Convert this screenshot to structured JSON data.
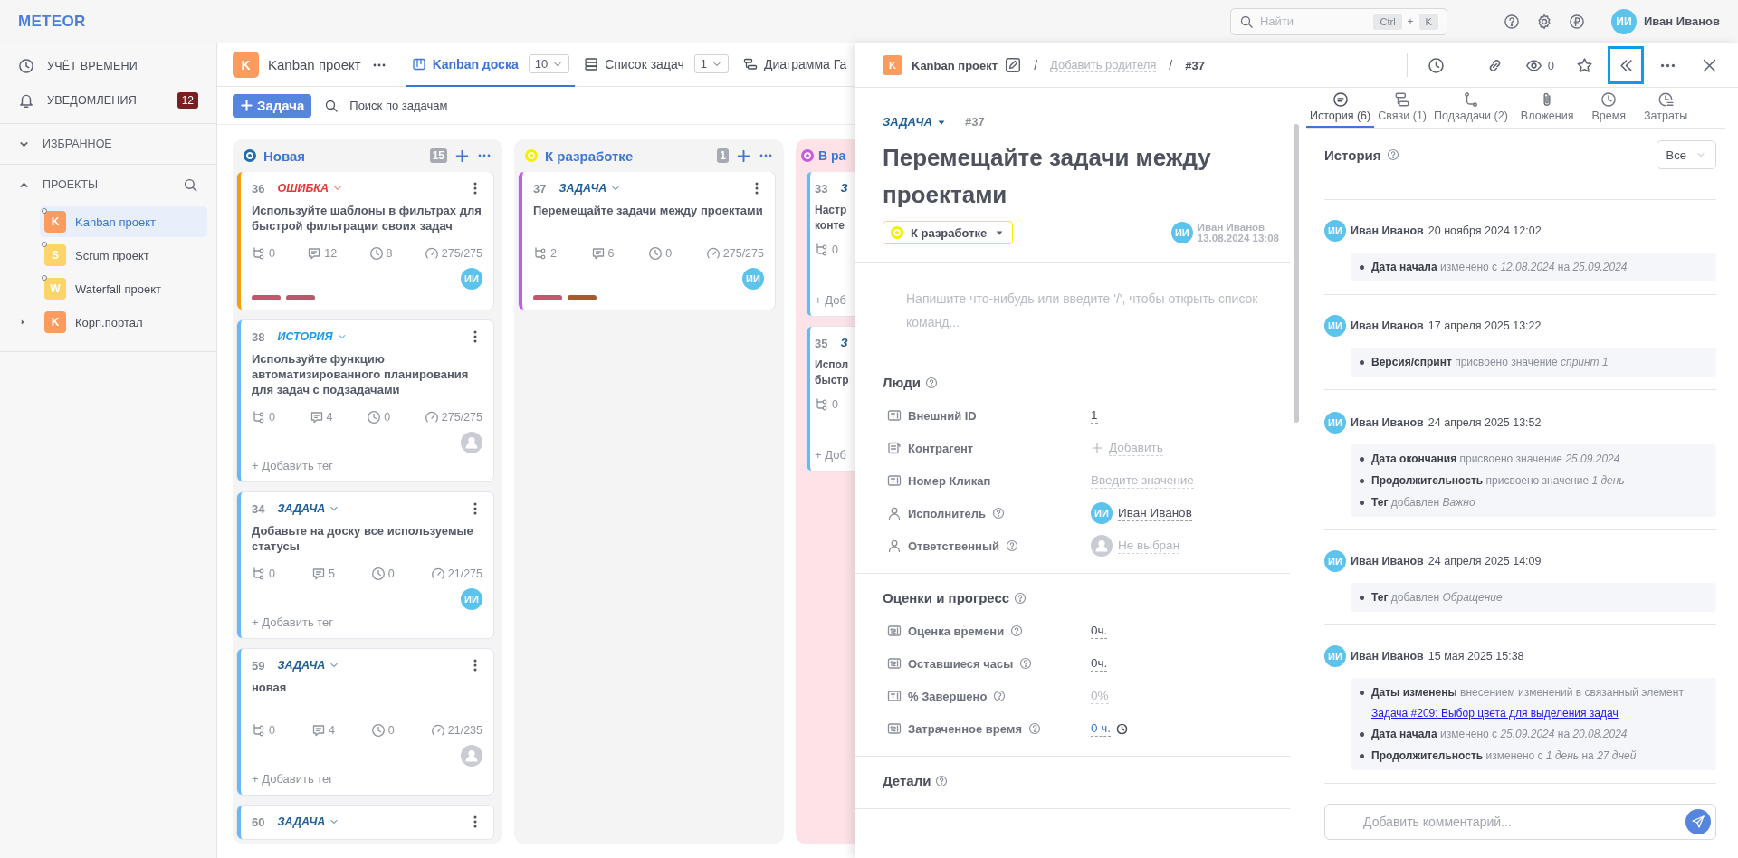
{
  "app": {
    "logo": "METEOR"
  },
  "topbar": {
    "search": {
      "placeholder": "Найти",
      "keys": [
        "Ctrl",
        "+",
        "K"
      ]
    },
    "user": {
      "initials": "ИИ",
      "name": "Иван Иванов"
    }
  },
  "sidebar": {
    "items": [
      {
        "kind": "time",
        "label": "УЧЁТ ВРЕМЕНИ"
      },
      {
        "kind": "notifications",
        "label": "УВЕДОМЛЕНИЯ",
        "badge": "12"
      }
    ],
    "sections": [
      {
        "label": "ИЗБРАННОЕ",
        "expanded": false,
        "searchable": false
      },
      {
        "label": "ПРОЕКТЫ",
        "expanded": true,
        "searchable": true
      }
    ],
    "projects": [
      {
        "letter": "K",
        "name": "Kanban проект",
        "color": "#fb9b5e",
        "selected": true,
        "pinned": true,
        "collapsed": false
      },
      {
        "letter": "S",
        "name": "Scrum проект",
        "color": "#fcd46a",
        "selected": false,
        "pinned": true,
        "collapsed": false
      },
      {
        "letter": "W",
        "name": "Waterfall проект",
        "color": "#fcd46a",
        "selected": false,
        "pinned": true,
        "collapsed": false
      },
      {
        "letter": "K",
        "name": "Корп.портал",
        "color": "#fb9b5e",
        "selected": false,
        "pinned": false,
        "collapsed": true
      }
    ]
  },
  "board": {
    "project": {
      "letter": "K",
      "name": "Kanban проект"
    },
    "views": [
      {
        "kind": "board",
        "label": "Kanban доска",
        "count": "10",
        "selected": true
      },
      {
        "kind": "list",
        "label": "Список задач",
        "count": "1",
        "selected": false
      },
      {
        "kind": "gantt",
        "label": "Диаграмма Га",
        "selected": false
      }
    ],
    "new_button": "Задача",
    "search_placeholder": "Поиск по задачам",
    "columns": [
      {
        "kind": "new",
        "title": "Новая",
        "color": "#1f6fb2",
        "count": "15",
        "cards": [
          {
            "number": "36",
            "kind": "bug",
            "type_label": "ОШИБКА",
            "title": "Используйте шаблоны в фильтрах для быстрой фильтрации своих задач",
            "color": "#f59e0b",
            "subtasks": "0",
            "comments": "12",
            "time": "8",
            "progress": "275/275",
            "assignee": {
              "kind": "user",
              "initials": "ИИ"
            },
            "tags": [
              {
                "color": "#c2566c"
              },
              {
                "color": "#b55a6c"
              }
            ]
          },
          {
            "number": "38",
            "kind": "story",
            "type_label": "ИСТОРИЯ",
            "title": "Используйте функцию автоматизированного планирования для задач с подзадачами",
            "color": "#6ab7f5",
            "subtasks": "0",
            "comments": "4",
            "time": "0",
            "progress": "275/275",
            "assignee": {
              "kind": "none"
            },
            "add_tag": "+ Добавить тег"
          },
          {
            "number": "34",
            "kind": "task",
            "type_label": "ЗАДАЧА",
            "title": "Добавьте на доску все используемые статусы",
            "color": "#6ab7f5",
            "subtasks": "0",
            "comments": "5",
            "time": "0",
            "progress": "21/275",
            "assignee": {
              "kind": "user",
              "initials": "ИИ"
            },
            "add_tag": "+ Добавить тег"
          },
          {
            "number": "59",
            "kind": "task",
            "type_label": "ЗАДАЧА",
            "title": "новая",
            "color": "#6ab7f5",
            "subtasks": "0",
            "comments": "4",
            "time": "0",
            "progress": "21/235",
            "assignee": {
              "kind": "none"
            },
            "add_tag": "+ Добавить тег"
          },
          {
            "number": "60",
            "kind": "task",
            "type_label": "ЗАДАЧА",
            "color": "#6ab7f5"
          }
        ]
      },
      {
        "kind": "todo",
        "title": "К разработке",
        "color": "#f2f200",
        "count": "1",
        "cards": [
          {
            "number": "37",
            "kind": "task",
            "type_label": "ЗАДАЧА",
            "title": "Перемещайте задачи между проектами",
            "color": "#c65be3",
            "subtasks": "2",
            "comments": "6",
            "time": "0",
            "progress": "275/275",
            "assignee": {
              "kind": "user",
              "initials": "ИИ"
            },
            "tags": [
              {
                "color": "#c2566c"
              },
              {
                "color": "#a65a30"
              }
            ]
          }
        ]
      },
      {
        "kind": "in_progress",
        "title": "В ра",
        "color": "#c65be3",
        "cards": [
          {
            "number": "33",
            "kind": "task",
            "type_label": "З",
            "title": "Настр конте",
            "color": "#6ab7f5",
            "subtasks": "0",
            "add_tag": "+ Доб"
          },
          {
            "number": "35",
            "kind": "task",
            "type_label": "З",
            "title": "Испол быстр",
            "color": "#6ab7f5",
            "subtasks": "0",
            "add_tag": "+ Доб"
          }
        ]
      }
    ]
  },
  "panel": {
    "breadcrumb": {
      "letter": "K",
      "project": "Kanban проект",
      "separators": [
        "/",
        "/"
      ],
      "parent_placeholder": "Добавить родителя",
      "id": "#37"
    },
    "actions": [
      {
        "kind": "history",
        "highlighted": false
      },
      {
        "kind": "link",
        "highlighted": false
      },
      {
        "kind": "watch",
        "count": "0",
        "highlighted": false
      },
      {
        "kind": "favorite",
        "highlighted": false
      },
      {
        "kind": "collapse",
        "highlighted": true
      },
      {
        "kind": "more",
        "highlighted": false
      },
      {
        "kind": "close",
        "highlighted": false
      }
    ],
    "task": {
      "type_label": "ЗАДАЧА",
      "number": "#37",
      "title": "Перемещайте задачи между проектами",
      "status": {
        "label": "К разработке",
        "color": "#f2f200"
      },
      "author": {
        "initials": "ИИ",
        "name": "Иван Иванов",
        "date": "13.08.2024 13:08"
      },
      "editor_placeholder": "Напишите что-нибудь или введите '/', чтобы открыть список команд...",
      "sections": [
        {
          "title": "Люди",
          "rows": [
            {
              "kind": "text",
              "label": "Внешний ID",
              "help": false,
              "value": {
                "kind": "value",
                "text": "1"
              }
            },
            {
              "kind": "record",
              "label": "Контрагент",
              "help": false,
              "value": {
                "kind": "add",
                "text": "Добавить"
              }
            },
            {
              "kind": "text",
              "label": "Номер Кликап",
              "help": false,
              "value": {
                "kind": "empty",
                "placeholder": "Введите значение"
              }
            },
            {
              "kind": "person",
              "label": "Исполнитель",
              "help": true,
              "value": {
                "kind": "user",
                "initials": "ИИ",
                "text": "Иван Иванов"
              }
            },
            {
              "kind": "person",
              "label": "Ответственный",
              "help": true,
              "value": {
                "kind": "nobody",
                "text": "Не выбран"
              }
            }
          ]
        },
        {
          "title": "Оценки и прогресс",
          "rows": [
            {
              "kind": "number",
              "label": "Оценка времени",
              "help": true,
              "value": {
                "kind": "value",
                "text": "0ч."
              }
            },
            {
              "kind": "number",
              "label": "Оставшиеся часы",
              "help": true,
              "value": {
                "kind": "value",
                "text": "0ч."
              }
            },
            {
              "kind": "text",
              "label": "% Завершено",
              "help": true,
              "value": {
                "kind": "empty",
                "placeholder": "0%"
              }
            },
            {
              "kind": "number",
              "label": "Затраченное время",
              "help": true,
              "value": {
                "kind": "timer",
                "text": "0 ч."
              }
            }
          ]
        },
        {
          "title": "Детали"
        }
      ]
    },
    "tabs": [
      {
        "label": "История (6)",
        "selected": true
      },
      {
        "label": "Связи (1)",
        "selected": false
      },
      {
        "label": "Подзадачи (2)",
        "selected": false
      },
      {
        "label": "Вложения",
        "selected": false
      },
      {
        "label": "Время",
        "selected": false
      },
      {
        "label": "Затраты",
        "selected": false
      }
    ],
    "history": {
      "title": "История",
      "filter": "Все",
      "entries": [
        {
          "initials": "ИИ",
          "author": "Иван Иванов",
          "date": "20 ноября 2024 12:02",
          "changes": [
            {
              "text": "**Дата начала** изменено с *12.08.2024* на *25.09.2024*"
            }
          ]
        },
        {
          "initials": "ИИ",
          "author": "Иван Иванов",
          "date": "17 апреля 2025 13:22",
          "changes": [
            {
              "text": "**Версия/спринт** присвоено значение *спринт 1*"
            }
          ]
        },
        {
          "initials": "ИИ",
          "author": "Иван Иванов",
          "date": "24 апреля 2025 13:52",
          "changes": [
            {
              "text": "**Дата окончания** присвоено значение *25.09.2024*"
            },
            {
              "text": "**Продолжительность** присвоено значение *1 день*"
            },
            {
              "text": "**Тег** добавлен *Важно*"
            }
          ]
        },
        {
          "initials": "ИИ",
          "author": "Иван Иванов",
          "date": "24 апреля 2025 14:09",
          "changes": [
            {
              "text": "**Тег** добавлен *Обращение*"
            }
          ]
        },
        {
          "initials": "ИИ",
          "author": "Иван Иванов",
          "date": "15 мая 2025 15:38",
          "changes": [
            {
              "text": "**Даты изменены** внесением изменений в связанный элемент",
              "link": "Задача #209: Выбор цвета для выделения задач"
            },
            {
              "text": "**Дата начала** изменено с *25.09.2024* на *20.08.2024*"
            },
            {
              "text": "**Продолжительность** изменено с *1 день* на *27 дней*"
            }
          ]
        }
      ]
    },
    "comment_placeholder": "Добавить комментарий..."
  }
}
